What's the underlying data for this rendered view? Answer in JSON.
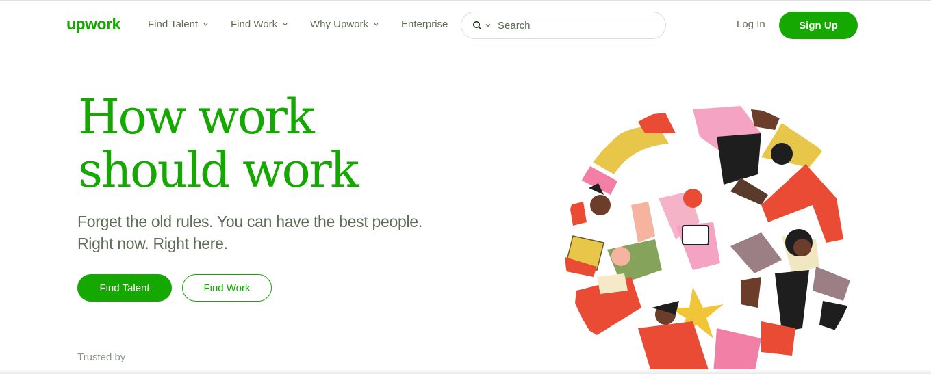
{
  "header": {
    "logo": "upwork",
    "nav": [
      {
        "label": "Find Talent",
        "has_dropdown": true
      },
      {
        "label": "Find Work",
        "has_dropdown": true
      },
      {
        "label": "Why Upwork",
        "has_dropdown": true
      },
      {
        "label": "Enterprise",
        "has_dropdown": false
      }
    ],
    "search": {
      "placeholder": "Search",
      "icon": "search-icon"
    },
    "login_label": "Log In",
    "signup_label": "Sign Up"
  },
  "hero": {
    "title": "How work should work",
    "subtitle": "Forget the old rules. You can have the best people. Right now. Right here.",
    "find_talent_label": "Find Talent",
    "find_work_label": "Find Work"
  },
  "trusted_label": "Trusted by",
  "colors": {
    "brand_green": "#14a800",
    "text_gray": "#5e6d55",
    "muted": "#8b968b"
  }
}
